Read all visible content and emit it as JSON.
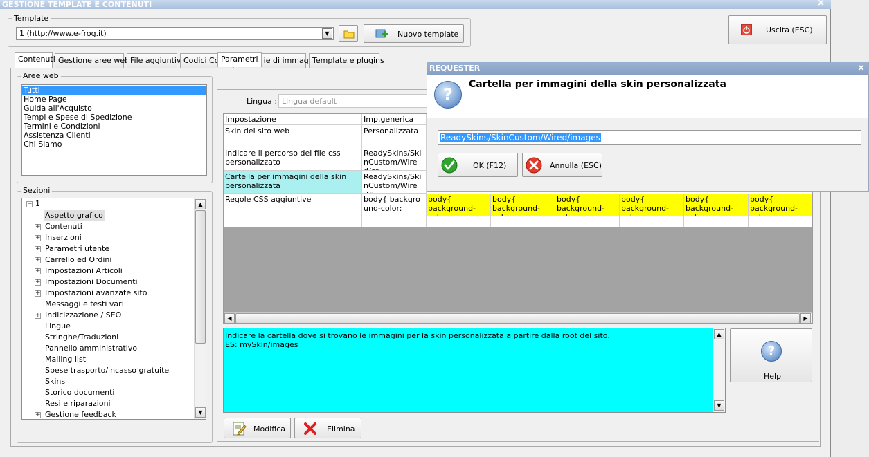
{
  "window": {
    "title": "GESTIONE TEMPLATE E CONTENUTI",
    "close": "×"
  },
  "template_group": {
    "label": "Template",
    "selected": "1 (http://www.e-frog.it)",
    "new_button": "Nuovo template"
  },
  "exit_button": "Uscita (ESC)",
  "tabs": [
    "Contenuti",
    "Gestione aree web",
    "File aggiuntivi",
    "Codici Coupon",
    "Gallerie di immagini",
    "Template e plugins"
  ],
  "aree_web": {
    "label": "Aree web",
    "items": [
      "Tutti",
      "Home Page",
      "Guida all'Acquisto",
      "Tempi e Spese di Spedizione",
      "Termini e Condizioni",
      "Assistenza Clienti",
      "Chi Siamo"
    ]
  },
  "sezioni": {
    "label": "Sezioni",
    "root": "1",
    "items": [
      {
        "label": "Aspetto grafico",
        "expandable": false,
        "selected": true
      },
      {
        "label": "Contenuti",
        "expandable": true
      },
      {
        "label": "Inserzioni",
        "expandable": true
      },
      {
        "label": "Parametri utente",
        "expandable": true
      },
      {
        "label": "Carrello ed Ordini",
        "expandable": true
      },
      {
        "label": "Impostazioni Articoli",
        "expandable": true
      },
      {
        "label": "Impostazioni Documenti",
        "expandable": true
      },
      {
        "label": "Impostazioni avanzate sito",
        "expandable": true
      },
      {
        "label": "Messaggi e testi vari",
        "expandable": false
      },
      {
        "label": "Indicizzazione / SEO",
        "expandable": true
      },
      {
        "label": "Lingue",
        "expandable": false
      },
      {
        "label": "Stringhe/Traduzioni",
        "expandable": false
      },
      {
        "label": "Pannello amministrativo",
        "expandable": false
      },
      {
        "label": "Mailing list",
        "expandable": false
      },
      {
        "label": "Spese trasporto/incasso gratuite",
        "expandable": false
      },
      {
        "label": "Skins",
        "expandable": false
      },
      {
        "label": "Storico documenti",
        "expandable": false
      },
      {
        "label": "Resi e riparazioni",
        "expandable": false
      },
      {
        "label": "Gestione feedback",
        "expandable": true
      }
    ]
  },
  "parametri": {
    "tab": "Parametri",
    "lingua_label": "Lingua :",
    "lingua_placeholder": "Lingua default",
    "columns": [
      "Impostazione",
      "Imp.generica"
    ],
    "rows": [
      {
        "name": "Skin del sito web",
        "value": "Personalizzata"
      },
      {
        "name": "Indicare il percorso del file css personalizzato",
        "value": "ReadySkins/SkinCustom/Wired/cs..."
      },
      {
        "name": "Cartella per immagini della skin personalizzata",
        "value": "ReadySkins/SkinCustom/Wired/im..."
      },
      {
        "name": "Regole CSS aggiuntive",
        "value": "body{ background-color:"
      }
    ],
    "extra_cell": "body{ background-color:",
    "extra_cell_count": 6
  },
  "description": {
    "line1": "Indicare la cartella dove si trovano le immagini per la skin personalizzata a partire dalla root del sito.",
    "line2": "ES: mySkin/images"
  },
  "help_button": "Help",
  "modifica_button": "Modifica",
  "elimina_button": "Elimina",
  "requester": {
    "title": "REQUESTER",
    "close": "×",
    "heading": "Cartella per immagini della skin personalizzata",
    "value": "ReadySkins/SkinCustom/Wired/images",
    "ok_button": "OK (F12)",
    "cancel_button": "Annulla (ESC)"
  },
  "colors": {
    "selection": "#3399ff",
    "yellow": "#ffff00",
    "cyan": "#00ffff",
    "highlight_row": "#aaf0f0"
  }
}
